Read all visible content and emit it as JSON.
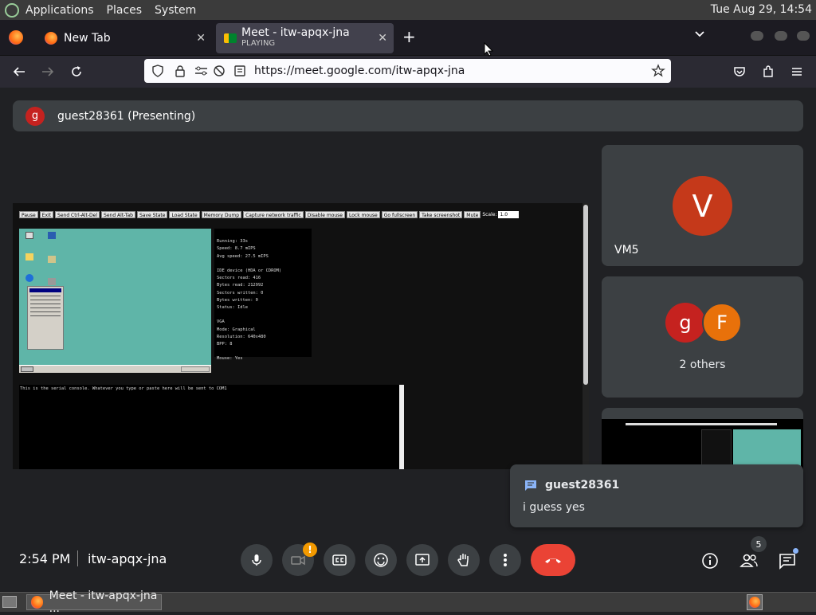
{
  "topbar": {
    "menus": [
      "Applications",
      "Places",
      "System"
    ],
    "clock": "Tue Aug 29, 14:54"
  },
  "browser": {
    "tabs": [
      {
        "title": "New Tab",
        "close_icon": "close-icon"
      },
      {
        "title": "Meet - itw-apqx-jna",
        "subtitle": "PLAYING",
        "close_icon": "close-icon"
      }
    ],
    "url": "https://meet.google.com/itw-apqx-jna"
  },
  "meet": {
    "presenting_name": "guest28361 (Presenting)",
    "presenting_initial": "g",
    "participants": [
      {
        "initial": "V",
        "name": "VM5",
        "color": "#c5391a"
      },
      {
        "initials": [
          "g",
          "F"
        ],
        "label": "2 others",
        "colors": [
          "#c5221f",
          "#e8710a"
        ]
      }
    ],
    "chat_popup": {
      "sender": "guest28361",
      "message": "i guess yes"
    },
    "time": "2:54 PM",
    "meeting_code": "itw-apqx-jna",
    "people_count": "5",
    "warning_badge": "!",
    "accent": "#ea4335"
  },
  "shared_screen": {
    "buttons": [
      "Pause",
      "Exit",
      "Send Ctrl-Alt-Del",
      "Send Alt-Tab",
      "Save State",
      "Load State",
      "Memory Dump",
      "Capture network traffic",
      "Disable mouse",
      "Lock mouse",
      "Go fullscreen",
      "Take screenshot",
      "Mute"
    ],
    "scale_label": "Scale:",
    "scale_value": "1.0",
    "stats": [
      "Running: 33s",
      "Speed: 8.7 mIPS",
      "Avg speed: 27.5 mIPS",
      "",
      "IDE device (HDA or CDROM)",
      "Sectors read: 416",
      "Bytes read: 212992",
      "Sectors written: 0",
      "Bytes written: 0",
      "Status: Idle",
      "",
      "VGA",
      "Mode: Graphical",
      "Resolution: 640x480",
      "BPP: 8",
      "",
      "Mouse: Yes"
    ],
    "serial_text": "This is the serial console. Whatever you type or paste here will be sent to COM1"
  },
  "taskbar": {
    "window_title": "Meet - itw-apqx-jna ..."
  }
}
